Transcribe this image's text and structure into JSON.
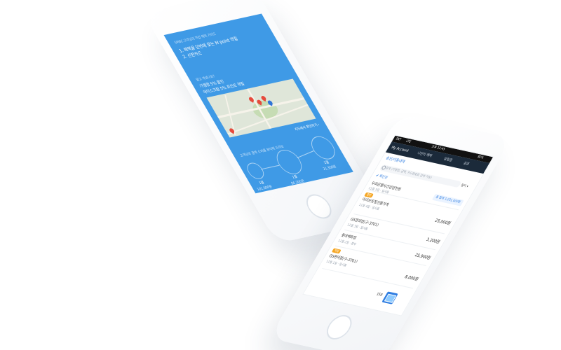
{
  "left_phone": {
    "title": "SMBC 고객님의 적립 혜택 가이드",
    "lines": [
      "1. 혜택을 단번에 찾는 M point 적립",
      "2. 신한카드"
    ],
    "question": "알고 계셨나요?",
    "offers": [
      "가맹점 5% 할인",
      "아이스크림 5% 포인트 적립"
    ],
    "map_link": "지도에서 확인하기 ›",
    "graph_title": "고객님의 결제 소비를 분석해 드려요",
    "stats": [
      {
        "label": "1월",
        "value": "101,000원"
      },
      {
        "label": "1월",
        "value": "86,300원"
      },
      {
        "label": "1월",
        "value": "21,300원"
      }
    ]
  },
  "right_phone": {
    "status": {
      "carrier": "SKT",
      "signal": "LTE",
      "time": "오후 12:45",
      "battery": "82%"
    },
    "tabs": [
      "My Account",
      "나만의 혜택",
      "알림함",
      "설정"
    ],
    "active_tab": "My Account",
    "subtitle": "승인/이용내역",
    "search_placeholder": "검색 (가맹점, 금액, 카드번호로 검색 가능)",
    "filter": "필터 ▾",
    "check_label": "✔ 확인된",
    "summary": "총 합계 1,021,000원",
    "transactions": [
      {
        "name": "우리은행사건강검진원",
        "meta": "11월 5일 · 일시불",
        "amount": "",
        "badge": ""
      },
      {
        "name": "아이브릿징선물가게",
        "meta": "11월 4일 · 일시불",
        "amount": "25,000원",
        "badge": "할인"
      },
      {
        "name": "GS편의점(구-3701)",
        "meta": "11월 3일 · 일시불",
        "amount": "3,200원",
        "badge": ""
      },
      {
        "name": "롯데백화점",
        "meta": "11월 2일 · 할부",
        "amount": "25,900원",
        "badge": ""
      },
      {
        "name": "GS편의점(구-3701)",
        "meta": "11월 1일 · 일시불",
        "amount": "8,000원",
        "badge": "적립"
      }
    ],
    "fab_label": "158"
  },
  "colors": {
    "left_screen": "#3f9ae6",
    "accent": "#2f7de1",
    "badge": "#f5a623",
    "pin": "#e64a3c"
  }
}
